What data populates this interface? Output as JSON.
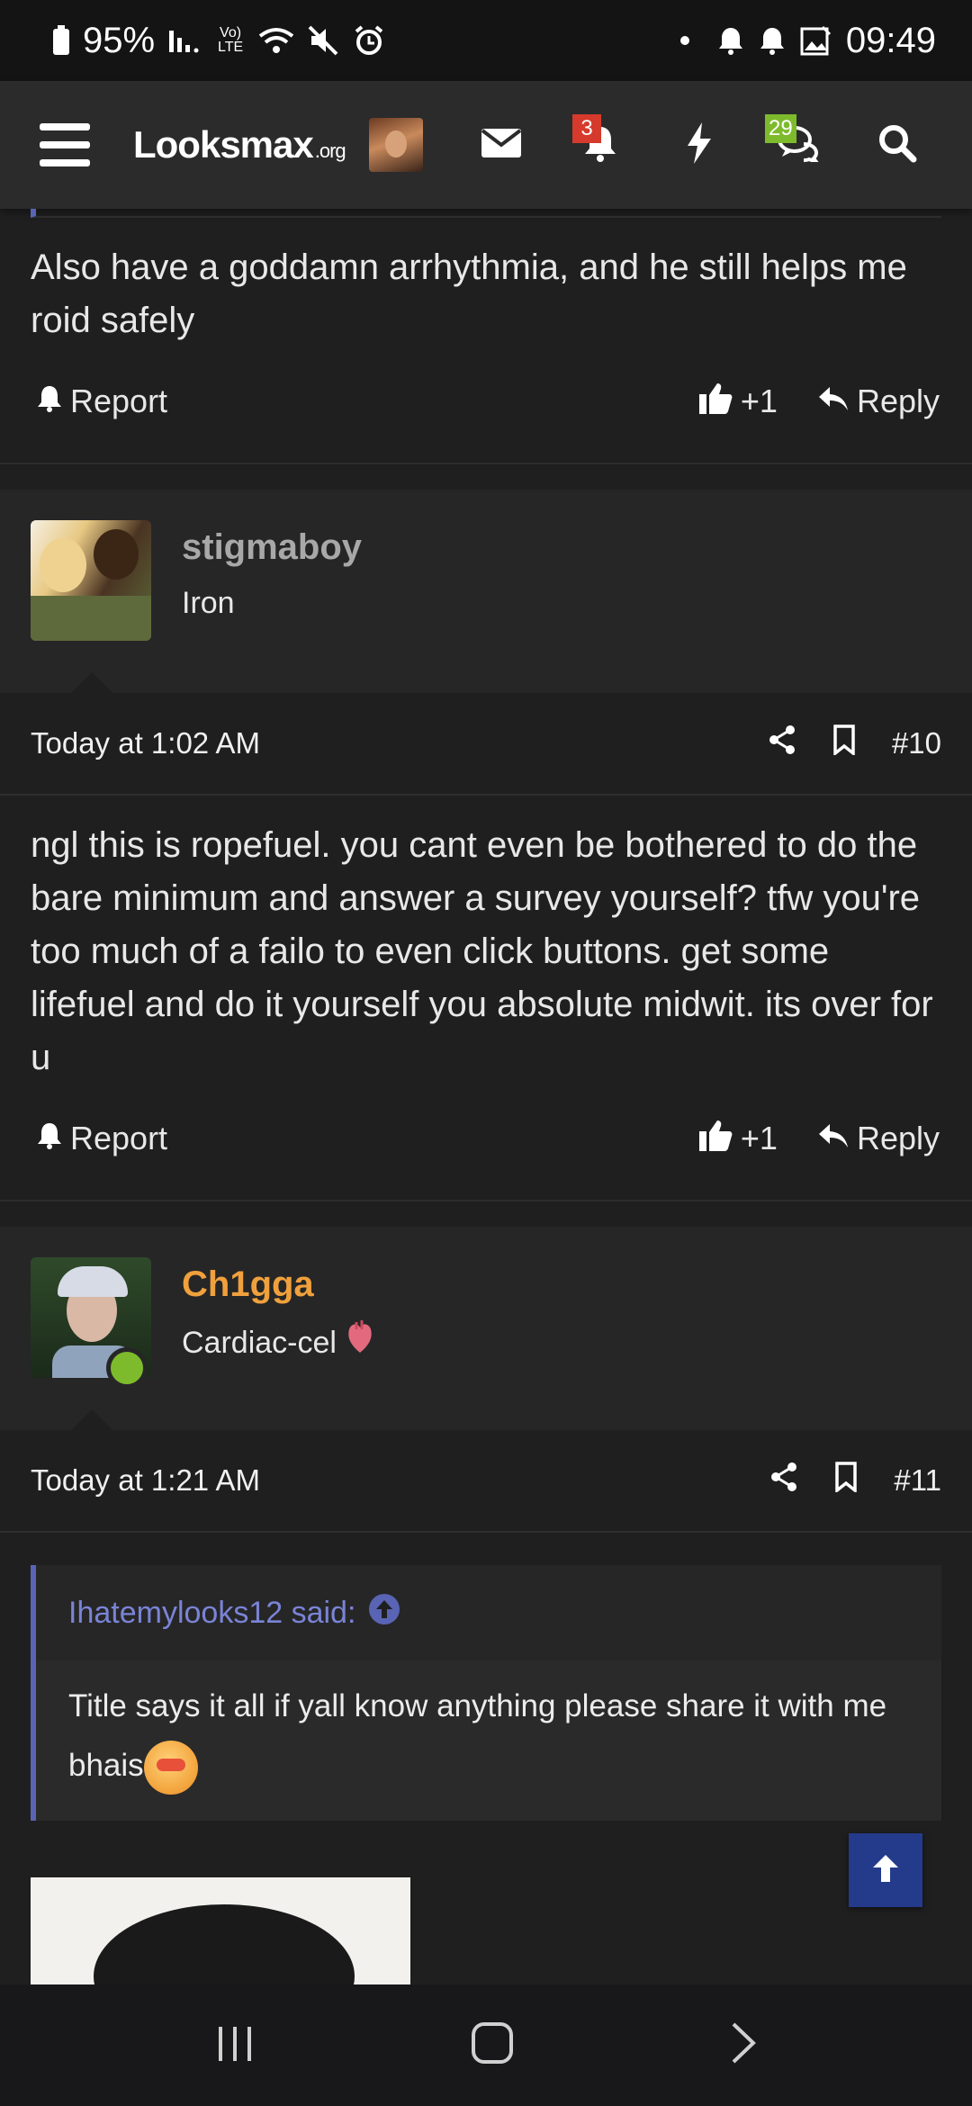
{
  "status_bar": {
    "battery": "95%",
    "network_label": "Vo) LTE",
    "time": "09:49"
  },
  "navbar": {
    "logo_main": "Looksmax",
    "logo_suffix": ".org",
    "alerts_badge": "3",
    "conversations_badge": "29"
  },
  "post9": {
    "text": "Also have a goddamn arrhythmia, and he still helps me roid safely",
    "report_label": "Report",
    "like_label": "+1",
    "reply_label": "Reply"
  },
  "post10": {
    "username": "stigmaboy",
    "user_title": "Iron",
    "time": "Today at 1:02 AM",
    "number": "#10",
    "text": "ngl this is ropefuel. you cant even be bothered to do the bare minimum and answer a survey yourself? tfw you're too much of a failo to even click buttons. get some lifefuel and do it yourself you absolute midwit. its over for u",
    "report_label": "Report",
    "like_label": "+1",
    "reply_label": "Reply"
  },
  "post11": {
    "username": "Ch1gga",
    "user_title": "Cardiac-cel",
    "time": "Today at 1:21 AM",
    "number": "#11",
    "quote_author": "Ihatemylooks12 said:",
    "quote_text": "Title says it all if yall know anything please share it with me bhais"
  },
  "colors": {
    "accent_blue": "#243a8a",
    "username_orange": "#f0a03c",
    "quote_blue": "#7a84d6",
    "badge_red": "#d63a2c",
    "badge_green": "#7dbb2c",
    "online_green": "#7dbb2c"
  }
}
